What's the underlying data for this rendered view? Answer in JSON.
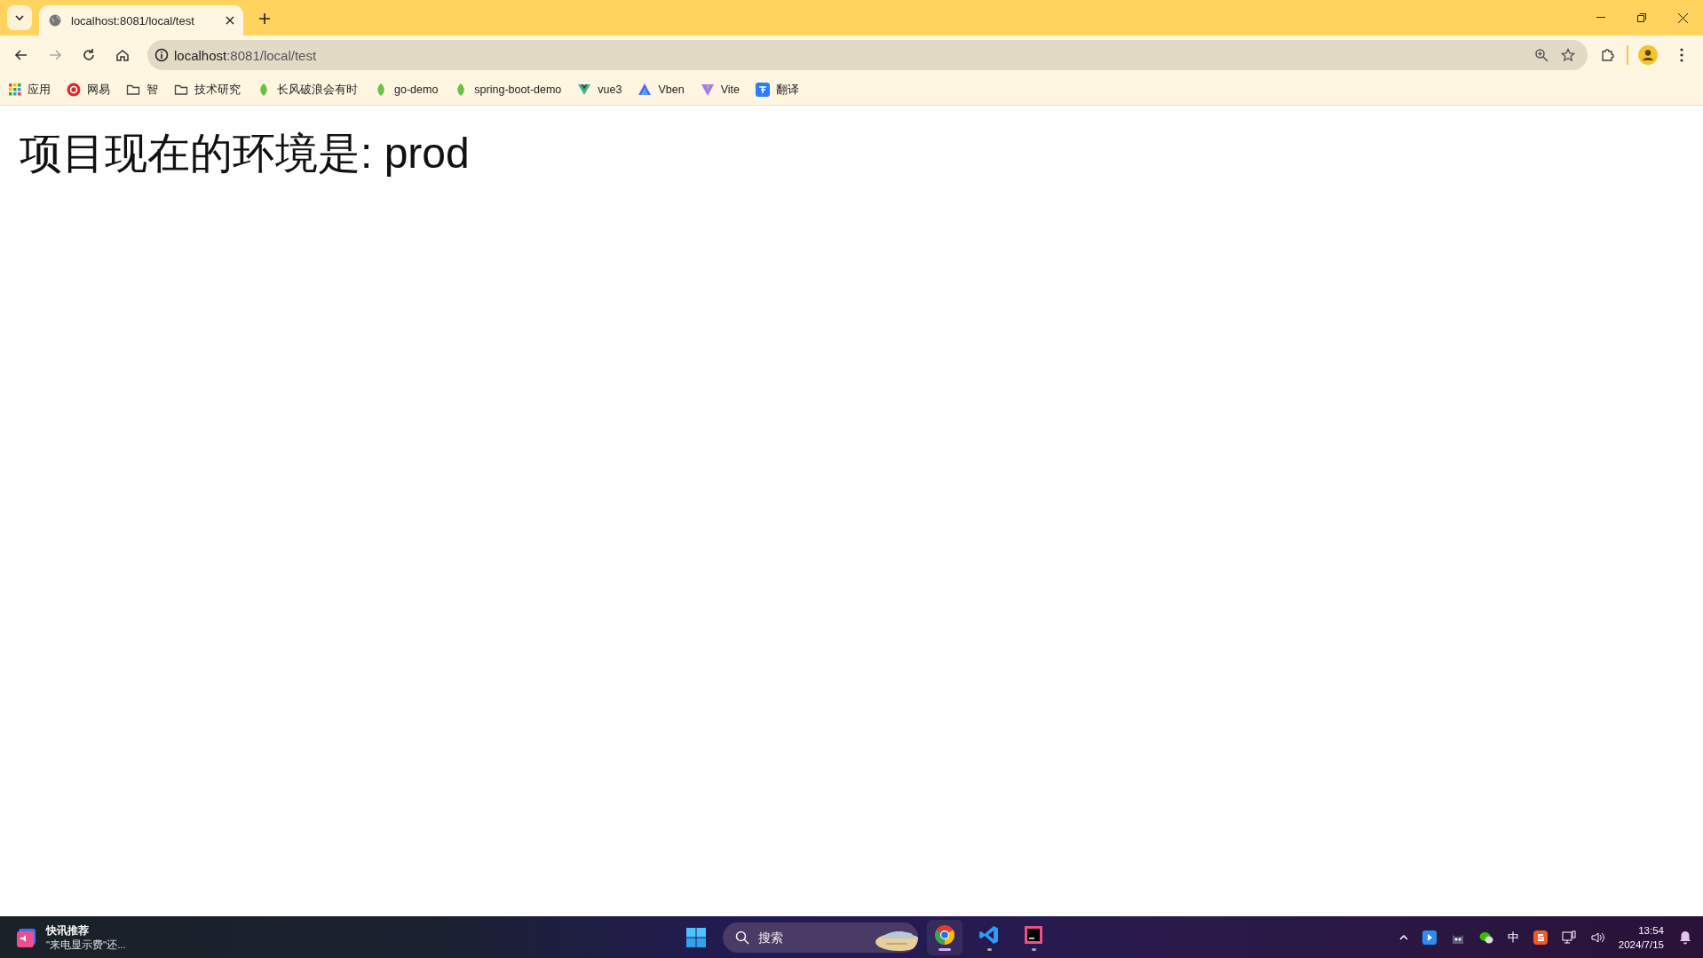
{
  "browser": {
    "tabs": [
      {
        "title": "localhost:8081/local/test",
        "selected": true
      }
    ],
    "address": {
      "host": "localhost",
      "rest": ":8081/local/test"
    },
    "bookmarks": [
      {
        "kind": "apps",
        "label": "应用"
      },
      {
        "kind": "netease",
        "label": "网易"
      },
      {
        "kind": "folder",
        "label": "智"
      },
      {
        "kind": "folder",
        "label": "技术研究"
      },
      {
        "kind": "leaf",
        "label": "长风破浪会有时"
      },
      {
        "kind": "leaf",
        "label": "go-demo"
      },
      {
        "kind": "leaf",
        "label": "spring-boot-demo"
      },
      {
        "kind": "vue",
        "label": "vue3"
      },
      {
        "kind": "vben",
        "label": "Vben"
      },
      {
        "kind": "vite",
        "label": "Vite"
      },
      {
        "kind": "translate",
        "label": "翻译"
      }
    ]
  },
  "page": {
    "heading": "项目现在的环境是: prod"
  },
  "taskbar": {
    "widget": {
      "title": "快讯推荐",
      "text": "\"来电显示费\"还..."
    },
    "search": {
      "placeholder": "搜索"
    },
    "apps": [
      {
        "kind": "chrome",
        "selected": true
      },
      {
        "kind": "vscode",
        "selected": false
      },
      {
        "kind": "idea",
        "selected": false
      }
    ],
    "tray": {
      "ime": "中",
      "time": "13:54",
      "date": "2024/7/15"
    }
  }
}
